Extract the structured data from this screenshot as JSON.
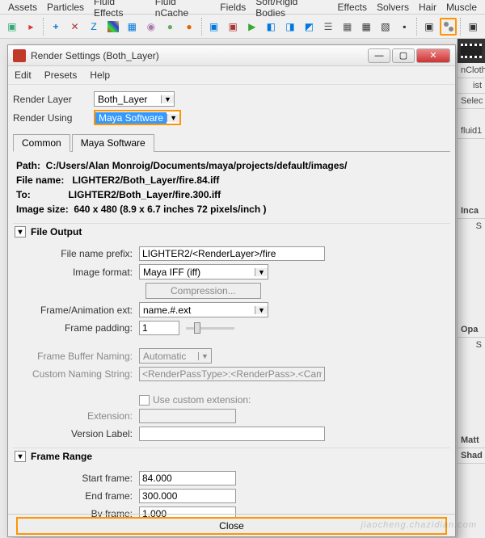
{
  "main_menu": {
    "items": [
      "Assets",
      "Particles",
      "Fluid Effects",
      "Fluid nCache",
      "Fields",
      "Soft/Rigid Bodies",
      "Effects",
      "Solvers",
      "Hair",
      "Muscle"
    ]
  },
  "right_tabs": {
    "ncloth": "nCloth",
    "list": "ist",
    "selec": "Selec",
    "fluid1": "fluid1",
    "incan": "Inca",
    "s1": "S",
    "opac": "Opa",
    "s2": "S",
    "matt": "Matt",
    "shad": "Shad"
  },
  "dialog": {
    "title": "Render Settings (Both_Layer)",
    "menus": {
      "edit": "Edit",
      "presets": "Presets",
      "help": "Help"
    },
    "render_layer": {
      "label": "Render Layer",
      "value": "Both_Layer"
    },
    "render_using": {
      "label": "Render Using",
      "value": "Maya Software"
    },
    "tabs": {
      "common": "Common",
      "maya_software": "Maya Software"
    },
    "info": {
      "path_label": "Path:  C:/Users/Alan Monroig/Documents/maya/projects/default/images/",
      "filename_label": "File name:   LIGHTER2/Both_Layer/fire.84.iff",
      "to_label": "To:              LIGHTER2/Both_Layer/fire.300.iff",
      "imagesize_label": "Image size:  640 x 480 (8.9 x 6.7 inches 72 pixels/inch )"
    },
    "file_output": {
      "header": "File Output",
      "prefix_label": "File name prefix:",
      "prefix_value": "LIGHTER2/<RenderLayer>/fire",
      "format_label": "Image format:",
      "format_value": "Maya IFF (iff)",
      "compression_label": "Compression...",
      "frame_ext_label": "Frame/Animation ext:",
      "frame_ext_value": "name.#.ext",
      "padding_label": "Frame padding:",
      "padding_value": "1",
      "buffer_label": "Frame Buffer Naming:",
      "buffer_value": "Automatic",
      "custom_label": "Custom Naming String:",
      "custom_value": "<RenderPassType>:<RenderPass>.<Cam",
      "use_custom_ext": "Use custom extension:",
      "extension_label": "Extension:",
      "version_label": "Version Label:"
    },
    "frame_range": {
      "header": "Frame Range",
      "start_label": "Start frame:",
      "start_value": "84.000",
      "end_label": "End frame:",
      "end_value": "300.000",
      "by_label": "By frame:",
      "by_value": "1.000"
    },
    "close_button": "Close"
  },
  "watermark": "jiaocheng.chazidian.com"
}
